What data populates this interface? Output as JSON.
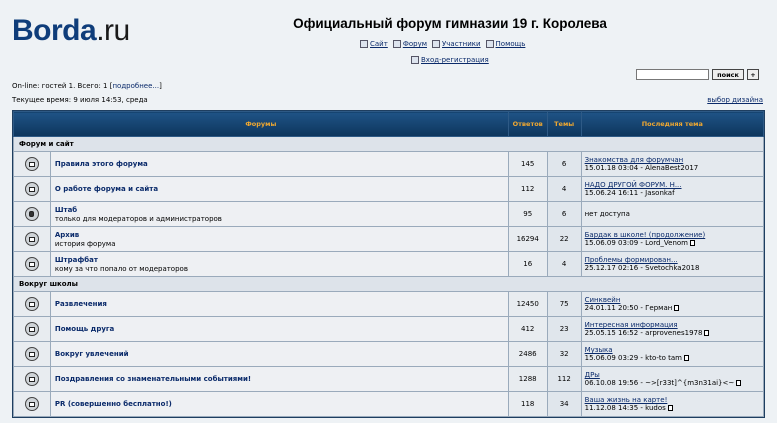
{
  "logo": {
    "brand": "Borda",
    "tld": ".ru"
  },
  "header": {
    "title": "Официальный форум гимназии 19 г. Королева",
    "nav": [
      {
        "label": "Сайт",
        "icon": "page-icon"
      },
      {
        "label": "Форум",
        "icon": "page-icon"
      },
      {
        "label": "Участники",
        "icon": "page-icon"
      },
      {
        "label": "Помощь",
        "icon": "help-icon"
      }
    ],
    "login_label": "Вход-регистрация"
  },
  "status": {
    "online_text": "On-line: гостей 1. Всего: 1 [",
    "online_link": "подробнее...",
    "online_close": "]",
    "current_time": "Текущее время: 9 июля 14:53, среда"
  },
  "search": {
    "placeholder": "",
    "button_label": "поиск",
    "plus_label": "+"
  },
  "design_link": "выбор дизайна",
  "table": {
    "headers": {
      "forums": "Форумы",
      "replies": "Ответов",
      "topics": "Темы",
      "last": "Последняя тема"
    },
    "categories": [
      {
        "name": "Форум и сайт",
        "forums": [
          {
            "title": "Правила этого форума",
            "desc": "",
            "replies": "145",
            "topics": "6",
            "last_topic": "Знакомства для форумчан",
            "last_info": "15.01.18 03:04 - AlenaBest2017",
            "locked": false,
            "paged": false
          },
          {
            "title": "О работе форума и сайта",
            "desc": "",
            "replies": "112",
            "topics": "4",
            "last_topic": "НАДО ДРУГОЙ ФОРУМ. Н...",
            "last_info": "15.06.24 16:11 - Jasonkaf",
            "locked": false,
            "paged": false
          },
          {
            "title": "Штаб",
            "desc": "только для модераторов и администраторов",
            "replies": "95",
            "topics": "6",
            "last_topic": "",
            "last_info": "нет доступа",
            "locked": true,
            "paged": false
          },
          {
            "title": "Архив",
            "desc": "история форума",
            "replies": "16294",
            "topics": "22",
            "last_topic": "Бардак в школе! (продолжение)",
            "last_info": "15.06.09 03:09 - Lord_Venom",
            "locked": false,
            "paged": true
          },
          {
            "title": "Штрафбат",
            "desc": "кому за что попало от модераторов",
            "replies": "16",
            "topics": "4",
            "last_topic": "Проблемы формирован...",
            "last_info": "25.12.17 02:16 - Svetochka2018",
            "locked": false,
            "paged": false
          }
        ]
      },
      {
        "name": "Вокруг школы",
        "forums": [
          {
            "title": "Развлечения",
            "desc": "",
            "replies": "12450",
            "topics": "75",
            "last_topic": "Синквейн",
            "last_info": "24.01.11 20:50 - Герман",
            "locked": false,
            "paged": true
          },
          {
            "title": "Помощь друга",
            "desc": "",
            "replies": "412",
            "topics": "23",
            "last_topic": "Интересная информация",
            "last_info": "25.05.15 16:52 - arprovenes1978",
            "locked": false,
            "paged": true
          },
          {
            "title": "Вокруг увлечений",
            "desc": "",
            "replies": "2486",
            "topics": "32",
            "last_topic": "Музыка",
            "last_info": "15.06.09 03:29 - kto-to tam",
            "locked": false,
            "paged": true
          },
          {
            "title": "Поздравления со знаменательными событиями!",
            "desc": "",
            "replies": "1288",
            "topics": "112",
            "last_topic": "ДРы",
            "last_info": "06.10.08 19:56 - ~>[r33t]^{m3n31ai}<~",
            "locked": false,
            "paged": true
          },
          {
            "title": "PR (совершенно бесплатно!)",
            "desc": "",
            "replies": "118",
            "topics": "34",
            "last_topic": "Ваша жизнь на карте!",
            "last_info": "11.12.08 14:35 - kudos",
            "locked": false,
            "paged": true
          }
        ]
      }
    ]
  }
}
